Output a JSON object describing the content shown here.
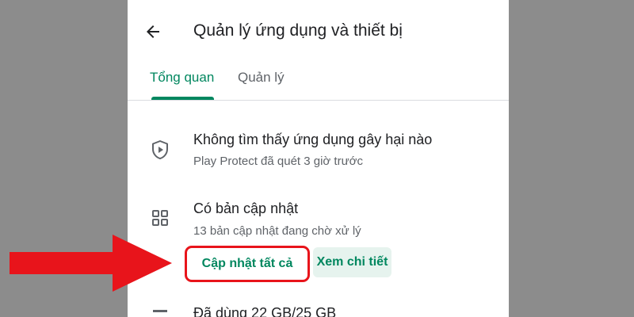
{
  "header": {
    "title": "Quản lý ứng dụng và thiết bị"
  },
  "tabs": [
    {
      "label": "Tổng quan",
      "active": true
    },
    {
      "label": "Quản lý",
      "active": false
    }
  ],
  "sections": {
    "play_protect": {
      "title": "Không tìm thấy ứng dụng gây hại nào",
      "subtitle": "Play Protect đã quét 3 giờ trước",
      "icon": "play-protect-shield-icon"
    },
    "updates": {
      "title": "Có bản cập nhật",
      "subtitle": "13 bản cập nhật đang chờ xử lý",
      "icon": "apps-grid-icon",
      "update_all_label": "Cập nhật tất cả",
      "details_label": "Xem chi tiết"
    },
    "storage": {
      "title": "Đã dùng 22 GB/25 GB",
      "icon": "storage-icon"
    }
  },
  "colors": {
    "accent": "#01875f",
    "highlight": "#e8141b",
    "background": "#8c8c8c"
  }
}
